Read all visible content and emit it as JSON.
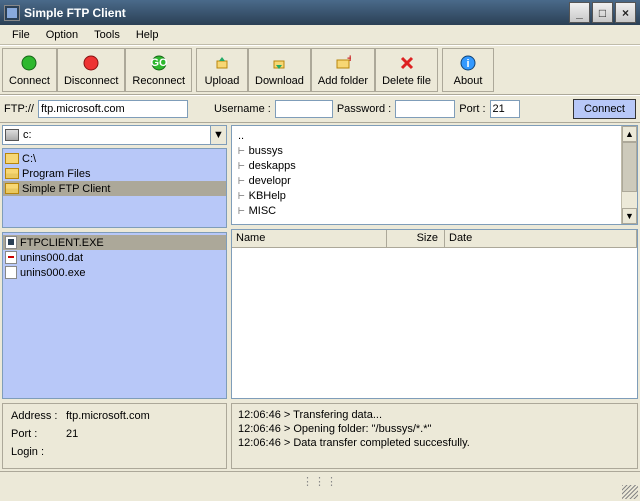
{
  "window": {
    "title": "Simple FTP Client"
  },
  "menu": {
    "file": "File",
    "option": "Option",
    "tools": "Tools",
    "help": "Help"
  },
  "toolbar": {
    "connect": "Connect",
    "disconnect": "Disconnect",
    "reconnect": "Reconnect",
    "upload": "Upload",
    "download": "Download",
    "addfolder": "Add folder",
    "deletefile": "Delete file",
    "about": "About"
  },
  "addr": {
    "ftplabel": "FTP://",
    "ftpvalue": "ftp.microsoft.com",
    "userlabel": "Username :",
    "uservalue": "",
    "passlabel": "Password :",
    "passvalue": "",
    "portlabel": "Port :",
    "portvalue": "21",
    "connect": "Connect"
  },
  "drive": {
    "label": "c:"
  },
  "tree": {
    "n0": "C:\\",
    "n1": "Program Files",
    "n2": "Simple FTP Client"
  },
  "localfiles": {
    "f0": "FTPCLIENT.EXE",
    "f1": "unins000.dat",
    "f2": "unins000.exe"
  },
  "remote": {
    "dotdot": "..",
    "r0": "bussys",
    "r1": "deskapps",
    "r2": "developr",
    "r3": "KBHelp",
    "r4": "MISC"
  },
  "cols": {
    "name": "Name",
    "size": "Size",
    "date": "Date"
  },
  "status": {
    "addrlabel": "Address :",
    "addrval": "ftp.microsoft.com",
    "portlabel": "Port :",
    "portval": "21",
    "loginlabel": "Login :",
    "loginval": ""
  },
  "log": {
    "l0": "12:06:46 > Transfering data...",
    "l1": "12:06:46 > Opening folder: \"/bussys/*.*\"",
    "l2": "12:06:46 > Data transfer completed succesfully."
  }
}
